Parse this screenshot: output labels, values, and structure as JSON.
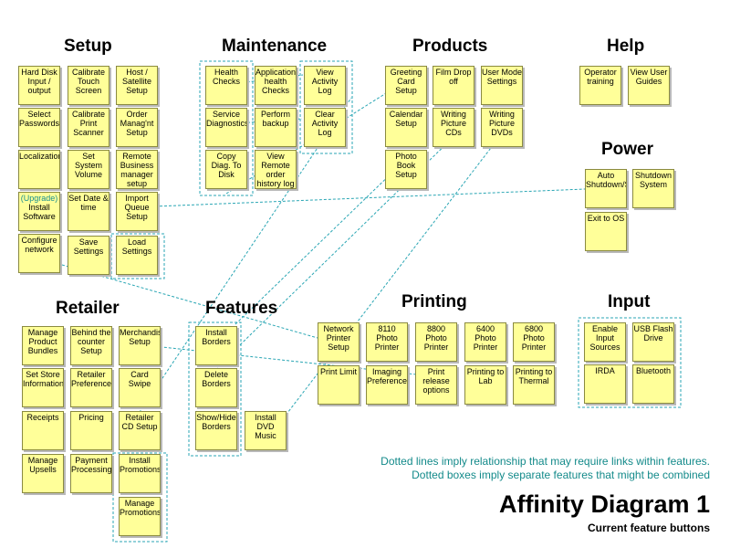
{
  "diagram": {
    "title": "Affinity Diagram 1",
    "subtitle": "Current feature buttons",
    "legend": [
      "Dotted lines imply relationship that may require links within features.",
      "Dotted boxes imply separate features that might be combined"
    ],
    "groups": {
      "setup": "Setup",
      "maintenance": "Maintenance",
      "products": "Products",
      "help": "Help",
      "power": "Power",
      "retailer": "Retailer",
      "features": "Features",
      "printing": "Printing",
      "input": "Input"
    },
    "notes": {
      "setup": [
        "Hard Disk Input / output",
        "Calibrate Touch Screen",
        "Host / Satellite Setup",
        "Select Passwords",
        "Calibrate Print Scanner",
        "Order Manag'nt Setup",
        "Localization",
        "Set System Volume",
        "Remote Business manager setup",
        "Install Software",
        "Set Date & time",
        "Import Queue Setup",
        "Configure network",
        "Save Settings",
        "Load Settings"
      ],
      "setup_upgrade_tag": "(Upgrade)",
      "maintenance": [
        "Health Checks",
        "Application health Checks",
        "View Activity Log",
        "Service Diagnostics",
        "Perform backup",
        "Clear Activity Log",
        "Copy Diag. To Disk",
        "View Remote order history log"
      ],
      "products": [
        "Greeting Card Setup",
        "Film Drop off",
        "User Mode Settings",
        "Calendar Setup",
        "Writing Picture CDs",
        "Writing Picture DVDs",
        "Photo Book Setup"
      ],
      "help": [
        "Operator training",
        "View User Guides"
      ],
      "power": [
        "Auto Shutdown/Startup",
        "Shutdown System",
        "Exit to OS"
      ],
      "retailer": [
        "Manage Product Bundles",
        "Behind the counter Setup",
        "Merchandising Setup",
        "Set Store Information",
        "Retailer Preferences",
        "Card Swipe",
        "Receipts",
        "Pricing",
        "Retailer CD Setup",
        "Manage Upsells",
        "Payment Processing",
        "Install Promotions",
        "Manage Promotions"
      ],
      "features": [
        "Install Borders",
        "Delete Borders",
        "Show/Hide Borders",
        "Install DVD Music"
      ],
      "printing": [
        "Network Printer Setup",
        "8110 Photo Printer",
        "8800 Photo Printer",
        "6400 Photo Printer",
        "6800 Photo Printer",
        "Print Limit",
        "Imaging Preferences",
        "Print release options",
        "Printing to Lab",
        "Printing to Thermal"
      ],
      "input": [
        "Enable Input Sources",
        "USB Flash Drive",
        "IRDA",
        "Bluetooth"
      ]
    },
    "colors": {
      "note": "#ffff99",
      "link": "#2aa6b4",
      "caption": "#138a8a"
    }
  }
}
